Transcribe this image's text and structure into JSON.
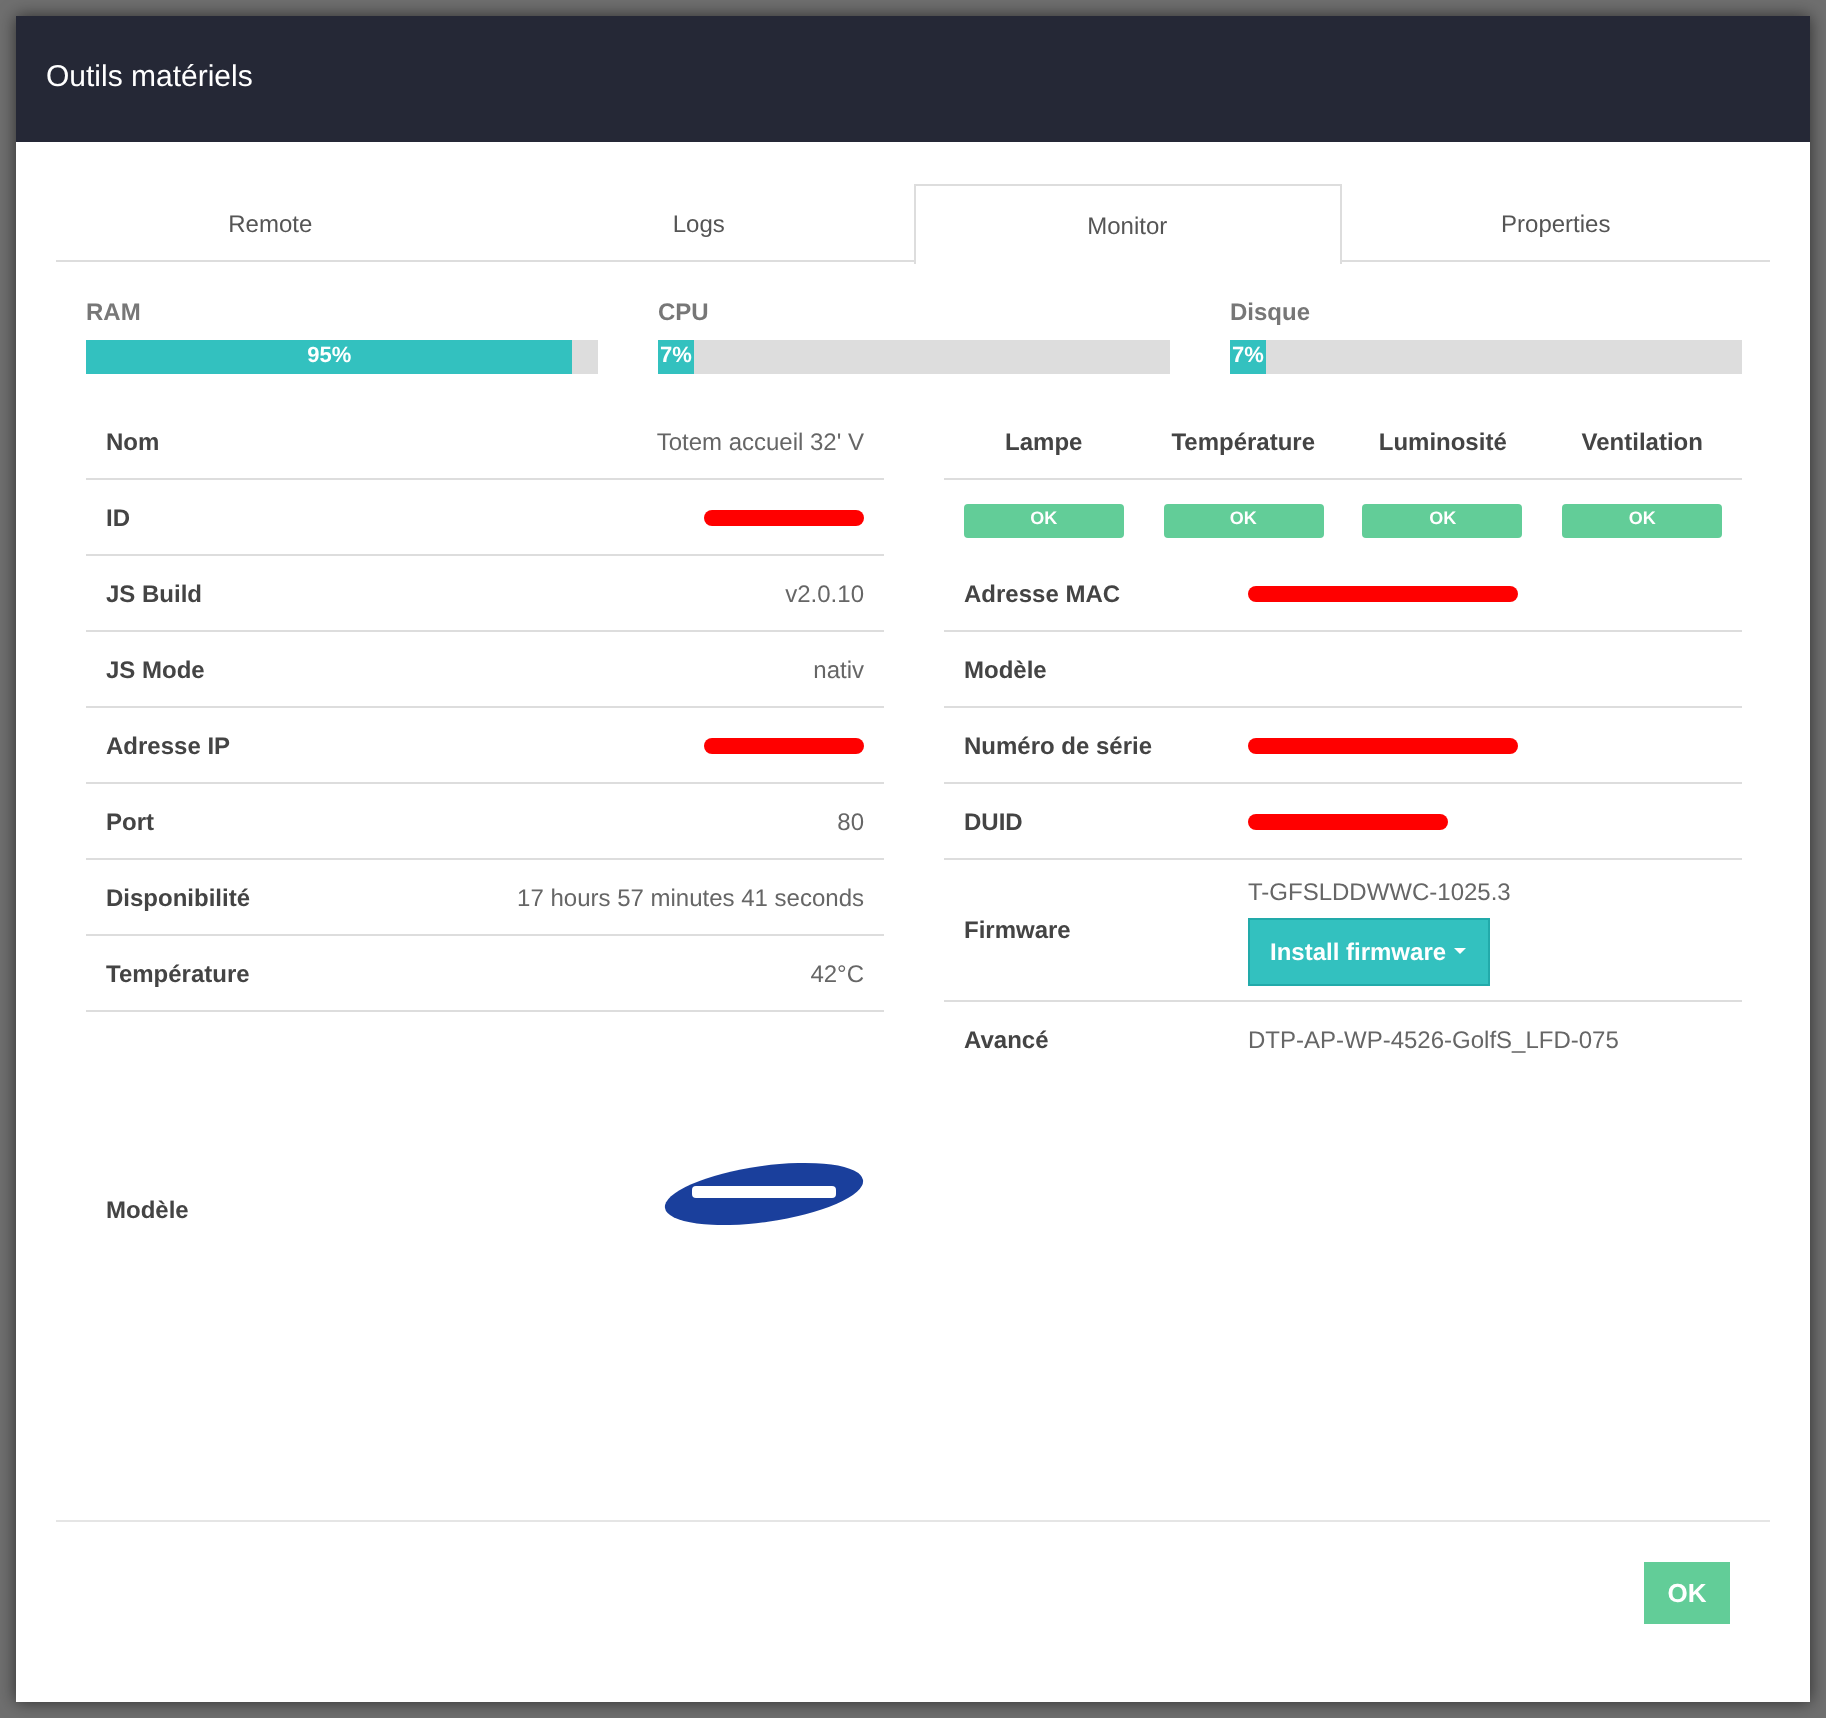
{
  "window": {
    "title": "Outils matériels"
  },
  "tabs": [
    {
      "label": "Remote",
      "selected": false
    },
    {
      "label": "Logs",
      "selected": false
    },
    {
      "label": "Monitor",
      "selected": true
    },
    {
      "label": "Properties",
      "selected": false
    }
  ],
  "meters": [
    {
      "label": "RAM",
      "level": 0.95,
      "reading": "95%"
    },
    {
      "label": "CPU",
      "level": 0.07,
      "reading": "7%"
    },
    {
      "label": "Disque",
      "level": 0.07,
      "reading": "7%"
    }
  ],
  "info": [
    {
      "kind": "text",
      "label": "Nom",
      "value": "Totem accueil 32' V"
    },
    {
      "kind": "redacted",
      "label": "ID"
    },
    {
      "kind": "text",
      "label": "JS Build",
      "value": "v2.0.10"
    },
    {
      "kind": "text",
      "label": "JS Mode",
      "value": "nativ"
    },
    {
      "kind": "redacted",
      "label": "Adresse IP"
    },
    {
      "kind": "text",
      "label": "Port",
      "value": "80"
    },
    {
      "kind": "text",
      "label": "Disponibilité",
      "value": "17 hours 57 minutes 41 seconds"
    },
    {
      "kind": "text",
      "label": "Température",
      "value": "42°C"
    },
    {
      "kind": "logo",
      "label": "Modèle"
    }
  ],
  "sensors": [
    {
      "label": "Lampe",
      "status": "OK"
    },
    {
      "label": "Température",
      "status": "OK"
    },
    {
      "label": "Luminosité",
      "status": "OK"
    },
    {
      "label": "Ventilation",
      "status": "OK"
    }
  ],
  "details": [
    {
      "kind": "redacted",
      "label": "Adresse MAC"
    },
    {
      "kind": "empty",
      "label": "Modèle"
    },
    {
      "kind": "redacted",
      "label": "Numéro de série"
    },
    {
      "kind": "redacted",
      "label": "DUID"
    },
    {
      "kind": "firmware",
      "label": "Firmware",
      "value": "T-GFSLDDWWC-1025.3",
      "button": "Install firmware"
    },
    {
      "kind": "text",
      "label": "Avancé",
      "value": "DTP-AP-WP-4526-GolfS_LFD-075"
    }
  ],
  "footer": {
    "button": "OK"
  }
}
